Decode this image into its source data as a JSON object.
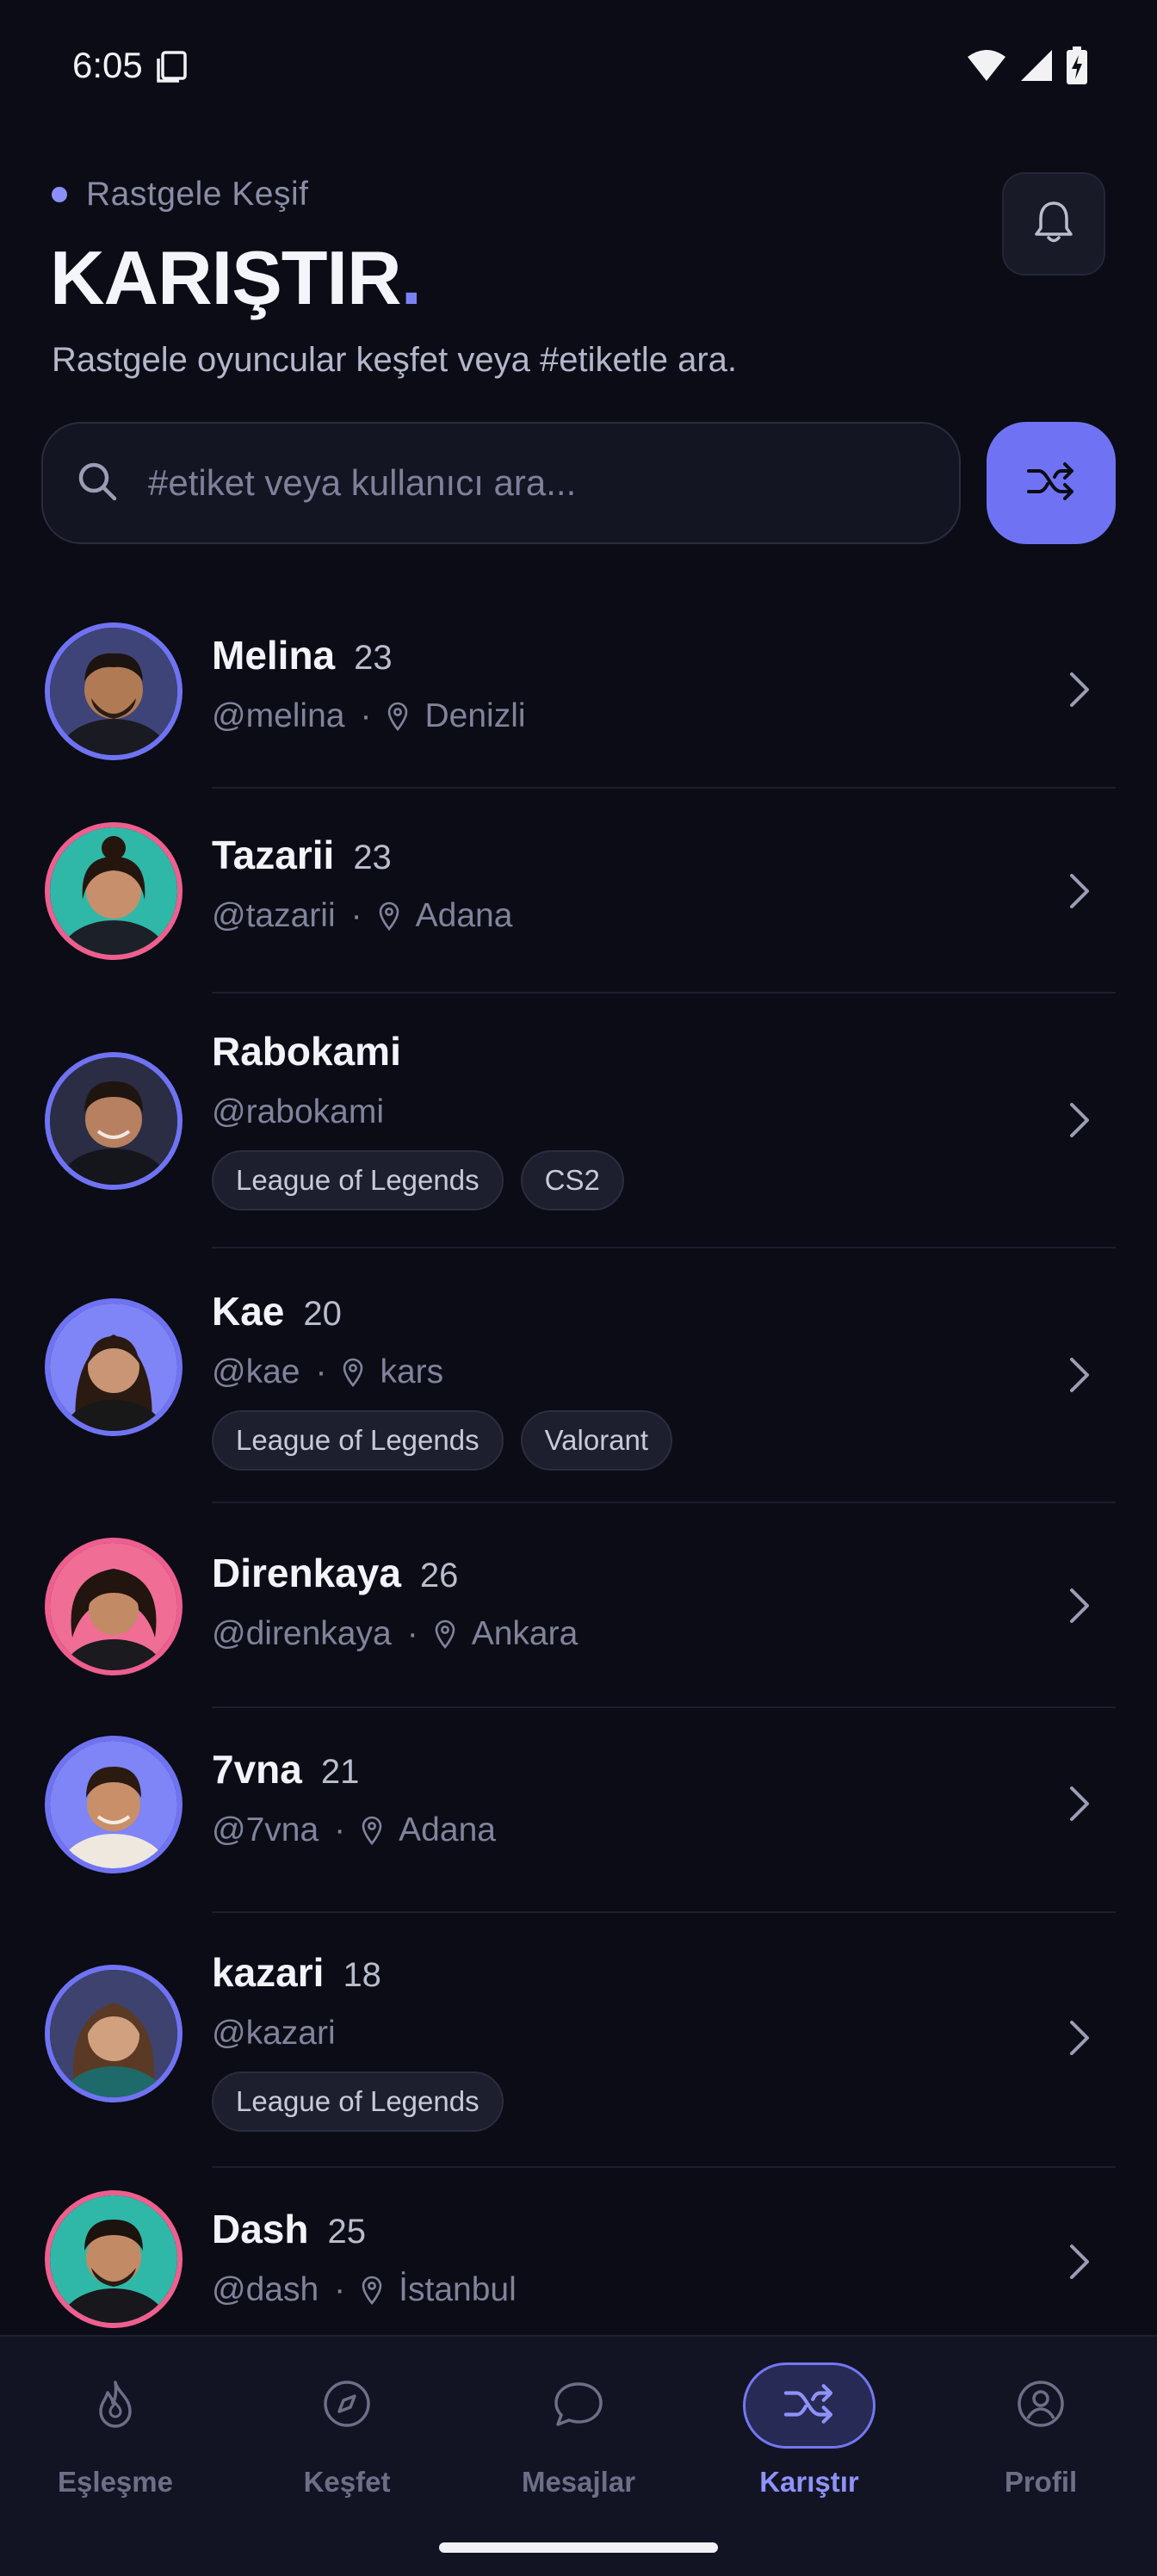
{
  "status_bar": {
    "time": "6:05"
  },
  "header": {
    "eyebrow": "Rastgele Keşif",
    "title": "KARIŞTIR",
    "title_dot": ".",
    "subtitle": "Rastgele oyuncular keşfet veya #etiketle ara."
  },
  "search": {
    "placeholder": "#etiket veya kullanıcı ara...",
    "value": ""
  },
  "users": [
    {
      "name": "Melina",
      "age": "23",
      "handle": "@melina",
      "location": "Denizli",
      "tags": []
    },
    {
      "name": "Tazarii",
      "age": "23",
      "handle": "@tazarii",
      "location": "Adana",
      "tags": []
    },
    {
      "name": "Rabokami",
      "age": "",
      "handle": "@rabokami",
      "location": "",
      "tags": [
        "League of Legends",
        "CS2"
      ]
    },
    {
      "name": "Kae",
      "age": "20",
      "handle": "@kae",
      "location": "kars",
      "tags": [
        "League of Legends",
        "Valorant"
      ]
    },
    {
      "name": "Direnkaya",
      "age": "26",
      "handle": "@direnkaya",
      "location": "Ankara",
      "tags": []
    },
    {
      "name": "7vna",
      "age": "21",
      "handle": "@7vna",
      "location": "Adana",
      "tags": []
    },
    {
      "name": "kazari",
      "age": "18",
      "handle": "@kazari",
      "location": "",
      "tags": [
        "League of Legends"
      ]
    },
    {
      "name": "Dash",
      "age": "25",
      "handle": "@dash",
      "location": "İstanbul",
      "tags": []
    }
  ],
  "nav": {
    "items": [
      {
        "label": "Eşleşme",
        "icon": "flame-icon"
      },
      {
        "label": "Keşfet",
        "icon": "compass-icon"
      },
      {
        "label": "Mesajlar",
        "icon": "chat-icon"
      },
      {
        "label": "Karıştır",
        "icon": "shuffle-icon"
      },
      {
        "label": "Profil",
        "icon": "profile-icon"
      }
    ],
    "active_index": 3
  },
  "colors": {
    "accent": "#6f73f3",
    "avatar_ring_blue": "#6f73f3",
    "avatar_ring_pink": "#ee5f8f",
    "background": "#0b0c15"
  }
}
